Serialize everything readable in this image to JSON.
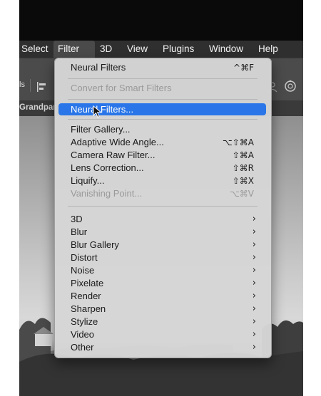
{
  "menubar": {
    "items": [
      {
        "label": "Select"
      },
      {
        "label": "Filter"
      },
      {
        "label": "3D"
      },
      {
        "label": "View"
      },
      {
        "label": "Plugins"
      },
      {
        "label": "Window"
      },
      {
        "label": "Help"
      }
    ]
  },
  "optionsbar": {
    "partial_text": "ls"
  },
  "tab": {
    "label": "Grandpar"
  },
  "filter_menu": {
    "top": [
      {
        "label": "Neural Filters",
        "shortcut": "^⌘F"
      },
      {
        "label": "Convert for Smart Filters",
        "disabled": true
      },
      {
        "label": "Neural Filters...",
        "highlighted": true
      }
    ],
    "group2": [
      {
        "label": "Filter Gallery...",
        "shortcut": ""
      },
      {
        "label": "Adaptive Wide Angle...",
        "shortcut": "⌥⇧⌘A"
      },
      {
        "label": "Camera Raw Filter...",
        "shortcut": "⇧⌘A"
      },
      {
        "label": "Lens Correction...",
        "shortcut": "⇧⌘R"
      },
      {
        "label": "Liquify...",
        "shortcut": "⇧⌘X"
      },
      {
        "label": "Vanishing Point...",
        "shortcut": "⌥⌘V",
        "disabled": true
      }
    ],
    "submenus": [
      {
        "label": "3D",
        "arrow": "›"
      },
      {
        "label": "Blur",
        "arrow": "›"
      },
      {
        "label": "Blur Gallery",
        "arrow": "›"
      },
      {
        "label": "Distort",
        "arrow": "›"
      },
      {
        "label": "Noise",
        "arrow": "›"
      },
      {
        "label": "Pixelate",
        "arrow": "›"
      },
      {
        "label": "Render",
        "arrow": "›"
      },
      {
        "label": "Sharpen",
        "arrow": "›"
      },
      {
        "label": "Stylize",
        "arrow": "›"
      },
      {
        "label": "Video",
        "arrow": "›"
      },
      {
        "label": "Other",
        "arrow": "›"
      }
    ]
  },
  "colors": {
    "highlight": "#2a76e8",
    "menubar": "#2f2f2f",
    "menu_bg": "#d6d6d6"
  }
}
